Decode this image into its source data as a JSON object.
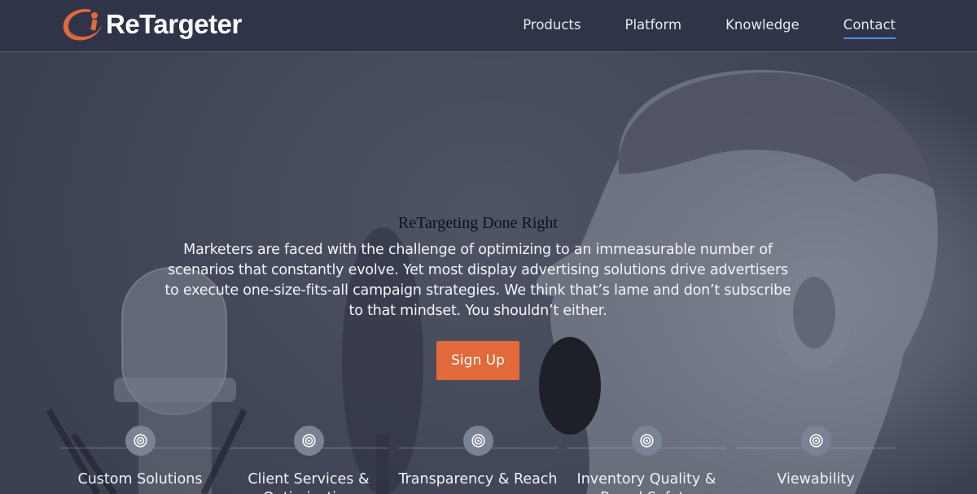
{
  "brand": {
    "name": "ReTargeter",
    "accent_color": "#e2693a",
    "header_color": "#2f3448"
  },
  "nav": {
    "items": [
      {
        "label": "Products"
      },
      {
        "label": "Platform"
      },
      {
        "label": "Knowledge"
      },
      {
        "label": "Contact",
        "active": true
      }
    ]
  },
  "hero": {
    "title": "ReTargeting Done Right",
    "body": "Marketers are faced with the challenge of optimizing to an immeasurable number of scenarios that constantly evolve. Yet most display advertising solutions drive advertisers to execute one-size-fits-all campaign strategies. We think that’s lame and don’t subscribe to that mindset. You shouldn’t either.",
    "cta_label": "Sign Up"
  },
  "features": [
    {
      "label": "Custom Solutions",
      "icon": "target-icon"
    },
    {
      "label": "Client Services & Optimization",
      "icon": "target-icon"
    },
    {
      "label": "Transparency & Reach",
      "icon": "target-icon"
    },
    {
      "label": "Inventory Quality & Brand Safety",
      "icon": "target-icon"
    },
    {
      "label": "Viewability",
      "icon": "target-icon"
    }
  ]
}
